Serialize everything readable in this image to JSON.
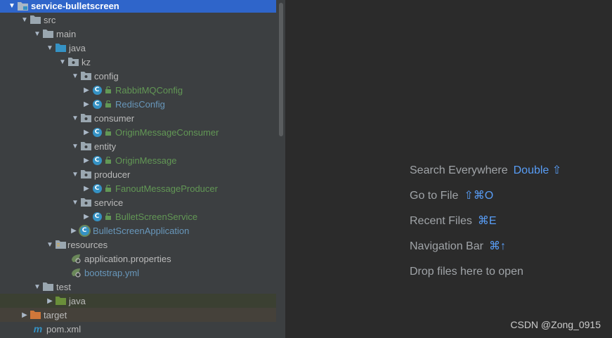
{
  "project_tree": {
    "root": "service-bulletscreen",
    "src": "src",
    "main": "main",
    "java": "java",
    "kz": "kz",
    "config": "config",
    "rabbitmq_config": "RabbitMQConfig",
    "redis_config": "RedisConfig",
    "consumer": "consumer",
    "origin_message_consumer": "OriginMessageConsumer",
    "entity": "entity",
    "origin_message": "OriginMessage",
    "producer": "producer",
    "fanout_message_producer": "FanoutMessageProducer",
    "service": "service",
    "bullet_screen_service": "BulletScreenService",
    "bullet_screen_application": "BulletScreenApplication",
    "resources": "resources",
    "application_properties": "application.properties",
    "bootstrap_yml": "bootstrap.yml",
    "test": "test",
    "test_java": "java",
    "target": "target",
    "pom_xml": "pom.xml",
    "class_badge": "C"
  },
  "editor_tips": [
    {
      "label": "Search Everywhere",
      "shortcut": "Double ⇧"
    },
    {
      "label": "Go to File",
      "shortcut": "⇧⌘O"
    },
    {
      "label": "Recent Files",
      "shortcut": "⌘E"
    },
    {
      "label": "Navigation Bar",
      "shortcut": "⌘↑"
    },
    {
      "label": "Drop files here to open",
      "shortcut": ""
    }
  ],
  "watermark": "CSDN @Zong_0915",
  "colors": {
    "selection": "#2f65ca",
    "panel": "#3c3f41",
    "editor": "#2b2b2b",
    "class_name_green": "#629755",
    "class_name_blue": "#6897bb",
    "shortcut": "#589df6"
  }
}
